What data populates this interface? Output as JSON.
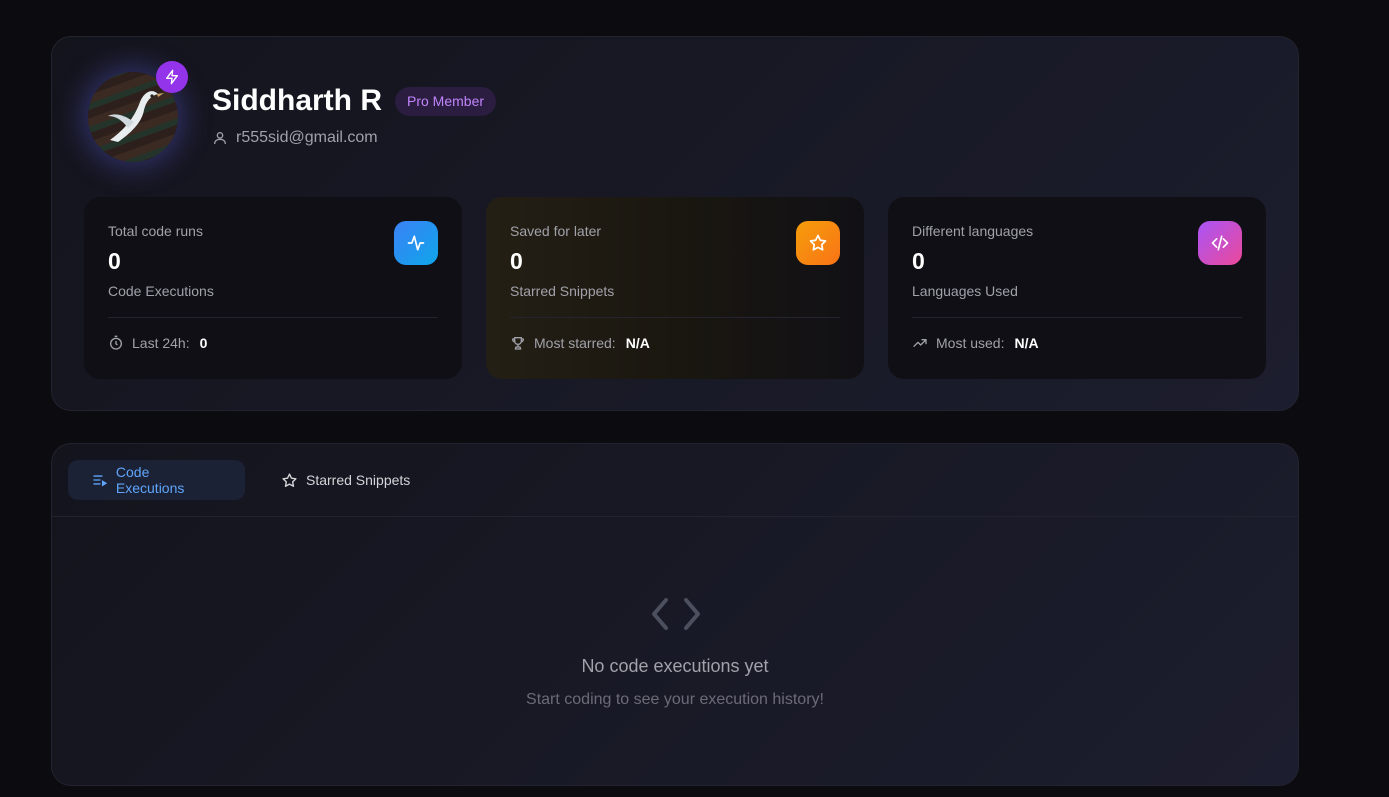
{
  "profile": {
    "name": "Siddharth R",
    "badge": "Pro Member",
    "email": "r555sid@gmail.com",
    "avatar_icon": "bird-avatar",
    "status_icon": "bolt-icon"
  },
  "stats": [
    {
      "label": "Total code runs",
      "value": "0",
      "sub": "Code Executions",
      "icon": "activity-icon",
      "color": "#3b82f6",
      "footer_icon": "timer-icon",
      "footer_label": "Last 24h:",
      "footer_value": "0"
    },
    {
      "label": "Saved for later",
      "value": "0",
      "sub": "Starred Snippets",
      "icon": "star-icon",
      "color": "#f59e0b",
      "footer_icon": "trophy-icon",
      "footer_label": "Most starred:",
      "footer_value": "N/A"
    },
    {
      "label": "Different languages",
      "value": "0",
      "sub": "Languages Used",
      "icon": "code-icon",
      "color": "#a855f7",
      "footer_icon": "trending-up-icon",
      "footer_label": "Most used:",
      "footer_value": "N/A"
    }
  ],
  "tabs": [
    {
      "label": "Code Executions",
      "icon": "list-play-icon",
      "active": true
    },
    {
      "label": "Starred Snippets",
      "icon": "star-icon",
      "active": false
    }
  ],
  "empty": {
    "title": "No code executions yet",
    "subtitle": "Start coding to see your execution history!",
    "icon": "code-brackets-icon"
  },
  "colors": {
    "background": "#0b0b10",
    "accent": "#60a5fa",
    "pro_badge": "#c084fc"
  }
}
